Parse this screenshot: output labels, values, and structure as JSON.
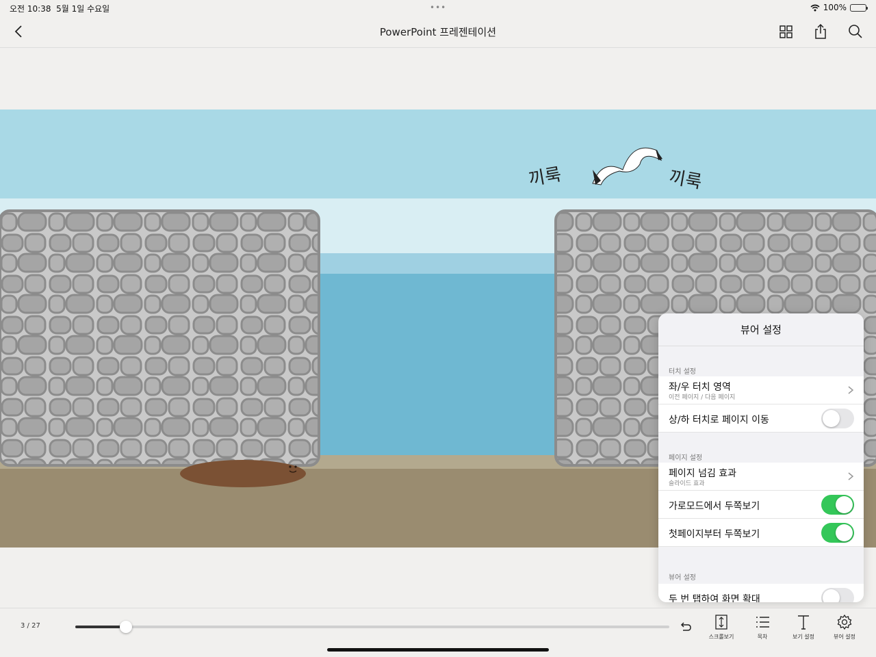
{
  "status_bar": {
    "time": "오전 10:38",
    "date": "5월 1일 수요일",
    "dots": "•••",
    "battery": "100%",
    "battery_level": 1.0
  },
  "nav": {
    "title": "PowerPoint 프레젠테이션",
    "icons": [
      "chevron-left-icon",
      "grid-icon",
      "share-icon",
      "search-icon"
    ]
  },
  "slide": {
    "label_left": "끼룩",
    "label_right": "끼룩"
  },
  "popover": {
    "title": "뷰어 설정",
    "sections": [
      {
        "header": "터치 설정",
        "rows": [
          {
            "label": "좌/우 터치 영역",
            "sub": "이전 페이지 / 다음 페이지",
            "type": "disclosure"
          },
          {
            "label": "상/하 터치로 페이지 이동",
            "type": "toggle",
            "value": false
          }
        ]
      },
      {
        "header": "페이지 설정",
        "rows": [
          {
            "label": "페이지 넘김 효과",
            "sub": "슬라이드 효과",
            "type": "disclosure"
          },
          {
            "label": "가로모드에서 두쪽보기",
            "type": "toggle",
            "value": true
          },
          {
            "label": "첫페이지부터 두쪽보기",
            "type": "toggle",
            "value": true
          }
        ]
      },
      {
        "header": "뷰어 설정",
        "rows": [
          {
            "label": "두 번 탭하여 화면 확대",
            "type": "toggle",
            "value": false
          }
        ]
      }
    ]
  },
  "bottom_bar": {
    "page_indicator": "3 / 27",
    "progress": 0.085,
    "tools": [
      {
        "label": "스크롤보기",
        "icon": "scroll-view-icon"
      },
      {
        "label": "목차",
        "icon": "list-icon"
      },
      {
        "label": "보기 설정",
        "icon": "text-icon"
      },
      {
        "label": "뷰어 설정",
        "icon": "gear-icon"
      }
    ]
  },
  "colors": {
    "toggle_on": "#34c759",
    "sky": "#a9d9e6",
    "sea": "#6fb8d2",
    "stone": "#a9a9a9",
    "ground": "#9a8c70"
  }
}
